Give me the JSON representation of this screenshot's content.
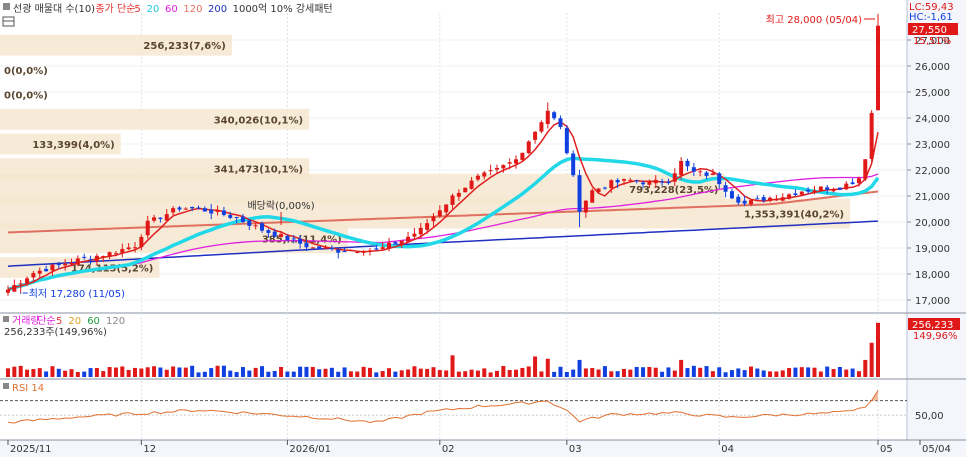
{
  "legend": {
    "price": [
      {
        "text": "선광 매물대 수(10)",
        "color": "#333333"
      },
      {
        "text": "종가 단순",
        "color": "#e03030"
      },
      {
        "text": "5",
        "color": "#e03030"
      },
      {
        "text": "20",
        "color": "#20c8e0"
      },
      {
        "text": "60",
        "color": "#e020e0"
      },
      {
        "text": "120",
        "color": "#e07060"
      },
      {
        "text": "200",
        "color": "#2030c0"
      },
      {
        "text": "1000억 10% 강세패턴",
        "color": "#333333"
      }
    ],
    "volume": [
      {
        "text": "거래량",
        "color": "#e020e0"
      },
      {
        "text": "단순",
        "color": "#e020e0"
      },
      {
        "text": "5",
        "color": "#e03030"
      },
      {
        "text": "20",
        "color": "#e0a020"
      },
      {
        "text": "60",
        "color": "#20a040"
      },
      {
        "text": "120",
        "color": "#888888"
      }
    ],
    "volume_summary": "256,233주(149,96%)",
    "rsi": {
      "text": "RSI 14",
      "color": "#e07030"
    }
  },
  "axis_right_top": {
    "lc": "LC:59,43",
    "hc": "HC:-1,61"
  },
  "price_ticks": [
    "27,000",
    "26,000",
    "25,000",
    "24,000",
    "23,000",
    "22,000",
    "21,000",
    "20,000",
    "19,000",
    "18,000",
    "17,000"
  ],
  "price_ticks_values": [
    27000,
    26000,
    25000,
    24000,
    23000,
    22000,
    21000,
    20000,
    19000,
    18000,
    17000
  ],
  "current_price": {
    "label": "27,550",
    "pct": "15,51%",
    "value": 27550
  },
  "volume_badge": {
    "label": "256,233",
    "pct": "149,96%"
  },
  "rsi_tick": "50,00",
  "date_labels": [
    {
      "text": "2025/11",
      "index": 0
    },
    {
      "text": "12",
      "index": 21
    },
    {
      "text": "2026/01",
      "index": 44
    },
    {
      "text": "02",
      "index": 68
    },
    {
      "text": "03",
      "index": 88
    },
    {
      "text": "04",
      "index": 112
    },
    {
      "text": "05",
      "index": 137
    },
    {
      "text": "05/04",
      "index": 145
    }
  ],
  "annotations": {
    "high": "최고 28,000 (05/04)",
    "low": "최저 17,280 (11/05)",
    "dividend": "배당락(0,00%)"
  },
  "volume_profile": [
    {
      "label": "256,233(7,6%)",
      "price_low": 26400,
      "price_high": 27200,
      "frac": 0.24
    },
    {
      "label": "0(0,0%)",
      "price_low": 25450,
      "price_high": 26250,
      "frac": 0.0
    },
    {
      "label": "0(0,0%)",
      "price_low": 24500,
      "price_high": 25300,
      "frac": 0.0
    },
    {
      "label": "340,026(10,1%)",
      "price_low": 23550,
      "price_high": 24350,
      "frac": 0.32
    },
    {
      "label": "133,399(4,0%)",
      "price_low": 22600,
      "price_high": 23400,
      "frac": 0.125
    },
    {
      "label": "341,473(10,1%)",
      "price_low": 21650,
      "price_high": 22450,
      "frac": 0.32
    },
    {
      "label": "793,228(23,5%)",
      "price_low": 20700,
      "price_high": 21850,
      "frac": 0.75
    },
    {
      "label": "1,353,391(40,2%)",
      "price_low": 19750,
      "price_high": 20900,
      "frac": 0.88
    },
    {
      "label": "385,...(11,4%)",
      "price_low": 18800,
      "price_high": 19950,
      "frac": 0.36
    },
    {
      "label": "174,115(5,2%)",
      "price_low": 17850,
      "price_high": 18650,
      "frac": 0.165
    }
  ],
  "chart_data": {
    "type": "candlestick",
    "title": "선광 매물대 수(10)",
    "y_range": [
      16800,
      28200
    ],
    "x_range": [
      "2025/11",
      "05/04"
    ],
    "close_anchors": [
      [
        0,
        17400
      ],
      [
        4,
        18050
      ],
      [
        8,
        18350
      ],
      [
        12,
        18600
      ],
      [
        16,
        18800
      ],
      [
        20,
        19100
      ],
      [
        22,
        19950
      ],
      [
        24,
        20200
      ],
      [
        27,
        20550
      ],
      [
        30,
        20500
      ],
      [
        33,
        20350
      ],
      [
        36,
        20150
      ],
      [
        40,
        19700
      ],
      [
        44,
        19350
      ],
      [
        48,
        19000
      ],
      [
        52,
        18900
      ],
      [
        56,
        18950
      ],
      [
        58,
        18900
      ],
      [
        62,
        19300
      ],
      [
        65,
        19700
      ],
      [
        68,
        20500
      ],
      [
        71,
        21200
      ],
      [
        74,
        21700
      ],
      [
        77,
        22000
      ],
      [
        80,
        22400
      ],
      [
        83,
        23500
      ],
      [
        85,
        24300
      ],
      [
        87,
        23600
      ],
      [
        88,
        22700
      ],
      [
        89,
        21700
      ],
      [
        90,
        20500
      ],
      [
        92,
        21200
      ],
      [
        95,
        21500
      ],
      [
        98,
        21600
      ],
      [
        101,
        21500
      ],
      [
        104,
        21600
      ],
      [
        106,
        22300
      ],
      [
        108,
        21900
      ],
      [
        111,
        21800
      ],
      [
        114,
        21000
      ],
      [
        116,
        20700
      ],
      [
        119,
        20900
      ],
      [
        122,
        21000
      ],
      [
        125,
        21200
      ],
      [
        128,
        21300
      ],
      [
        131,
        21350
      ],
      [
        133,
        21550
      ],
      [
        134,
        21700
      ],
      [
        135,
        22500
      ],
      [
        136,
        24200
      ],
      [
        137,
        27550
      ]
    ],
    "rsi_anchors": [
      [
        0,
        40
      ],
      [
        10,
        47
      ],
      [
        20,
        52
      ],
      [
        30,
        57
      ],
      [
        40,
        52
      ],
      [
        50,
        46
      ],
      [
        58,
        40
      ],
      [
        66,
        54
      ],
      [
        74,
        62
      ],
      [
        82,
        67
      ],
      [
        85,
        70
      ],
      [
        88,
        56
      ],
      [
        90,
        42
      ],
      [
        95,
        51
      ],
      [
        105,
        53
      ],
      [
        114,
        47
      ],
      [
        120,
        50
      ],
      [
        128,
        52
      ],
      [
        133,
        55
      ],
      [
        135,
        62
      ],
      [
        136,
        70
      ],
      [
        137,
        82
      ]
    ],
    "series": [
      {
        "name": "5",
        "color": "#e03030"
      },
      {
        "name": "20",
        "color": "#20c8e0"
      },
      {
        "name": "60",
        "color": "#e020e0"
      },
      {
        "name": "120",
        "color": "#e07060"
      },
      {
        "name": "200",
        "color": "#2030c0"
      }
    ],
    "current": 27550,
    "high": 28000,
    "low": 17280
  }
}
